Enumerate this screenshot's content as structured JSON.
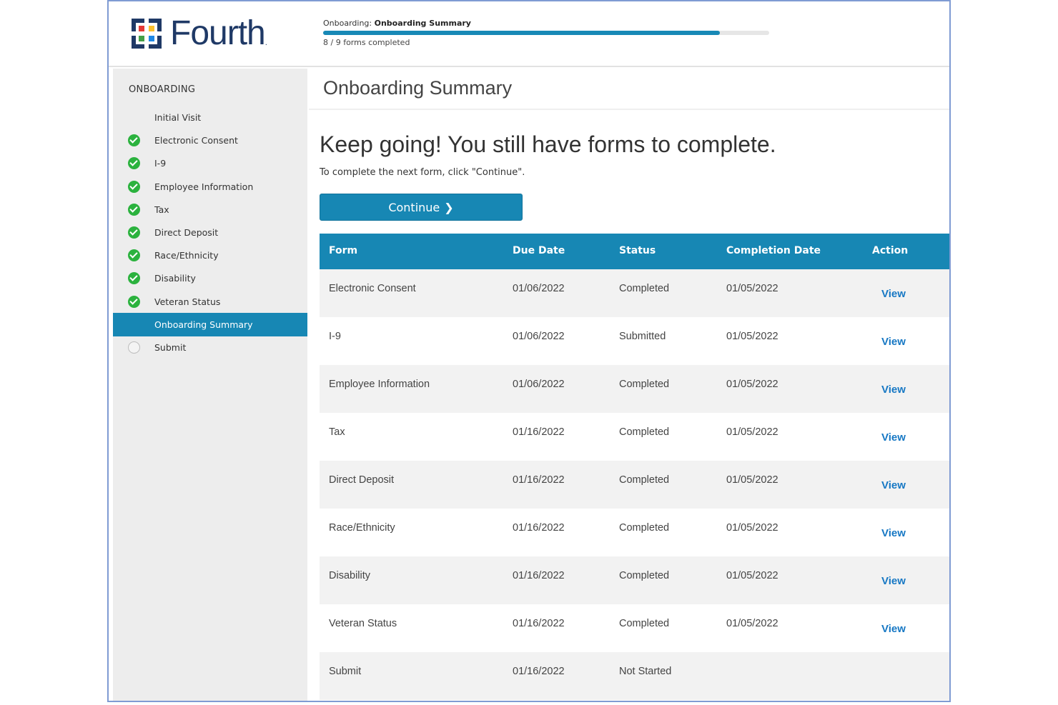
{
  "brand": {
    "name": "Fourth",
    "tm": "."
  },
  "progress": {
    "title_prefix": "Onboarding:",
    "title_current": "Onboarding Summary",
    "fraction": 0.8889,
    "count_text": "8 / 9 forms completed"
  },
  "sidebar": {
    "heading": "ONBOARDING",
    "items": [
      {
        "label": "Initial Visit",
        "status": "none"
      },
      {
        "label": "Electronic Consent",
        "status": "done"
      },
      {
        "label": "I-9",
        "status": "done"
      },
      {
        "label": "Employee Information",
        "status": "done"
      },
      {
        "label": "Tax",
        "status": "done"
      },
      {
        "label": "Direct Deposit",
        "status": "done"
      },
      {
        "label": "Race/Ethnicity",
        "status": "done"
      },
      {
        "label": "Disability",
        "status": "done"
      },
      {
        "label": "Veteran Status",
        "status": "done"
      },
      {
        "label": "Onboarding Summary",
        "status": "active"
      },
      {
        "label": "Submit",
        "status": "empty"
      }
    ]
  },
  "main": {
    "page_title": "Onboarding Summary",
    "headline": "Keep going! You still have forms to complete.",
    "instruction": "To complete the next form, click \"Continue\".",
    "continue_label": "Continue",
    "continue_icon": "chevron-right-icon"
  },
  "table": {
    "headers": [
      "Form",
      "Due Date",
      "Status",
      "Completion Date",
      "Action"
    ],
    "rows": [
      {
        "form": "Electronic Consent",
        "due": "01/06/2022",
        "status": "Completed",
        "completed": "01/05/2022",
        "action": "View"
      },
      {
        "form": "I-9",
        "due": "01/06/2022",
        "status": "Submitted",
        "completed": "01/05/2022",
        "action": "View"
      },
      {
        "form": "Employee Information",
        "due": "01/06/2022",
        "status": "Completed",
        "completed": "01/05/2022",
        "action": "View"
      },
      {
        "form": "Tax",
        "due": "01/16/2022",
        "status": "Completed",
        "completed": "01/05/2022",
        "action": "View"
      },
      {
        "form": "Direct Deposit",
        "due": "01/16/2022",
        "status": "Completed",
        "completed": "01/05/2022",
        "action": "View"
      },
      {
        "form": "Race/Ethnicity",
        "due": "01/16/2022",
        "status": "Completed",
        "completed": "01/05/2022",
        "action": "View"
      },
      {
        "form": "Disability",
        "due": "01/16/2022",
        "status": "Completed",
        "completed": "01/05/2022",
        "action": "View"
      },
      {
        "form": "Veteran Status",
        "due": "01/16/2022",
        "status": "Completed",
        "completed": "01/05/2022",
        "action": "View"
      },
      {
        "form": "Submit",
        "due": "01/16/2022",
        "status": "Not Started",
        "completed": "",
        "action": ""
      }
    ]
  },
  "colors": {
    "accent": "#1787b4",
    "success": "#2bb23e",
    "link": "#1778c4",
    "brand_text": "#1f3966"
  }
}
